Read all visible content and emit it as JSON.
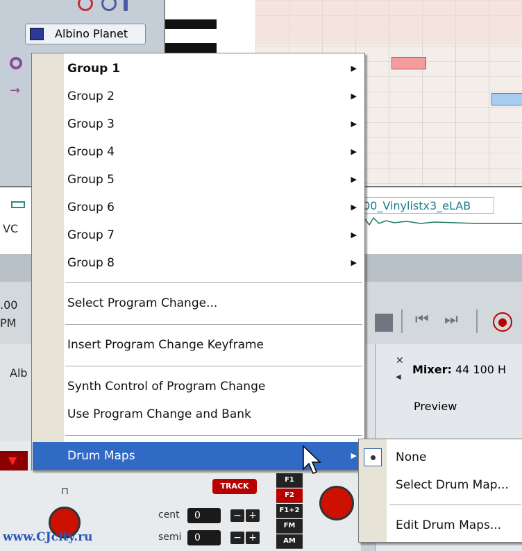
{
  "background": {
    "instrument_button": "Albino Planet",
    "clip_name": "00_Vinylistx3_eLAB",
    "track_fragment": "VC",
    "left_fragments": [
      ".00",
      "PM",
      "Alb"
    ],
    "mixer_title_bold": "Mixer:",
    "mixer_title_rest": " 44 100 H",
    "preview_label": "Preview",
    "track_button": "TRACK",
    "cent_label": "cent",
    "semi_label": "semi",
    "cent_value": "0",
    "semi_value": "0",
    "fkeys": [
      "F1",
      "F2",
      "F1+2",
      "FM",
      "AM"
    ],
    "watermark": "www.CJcity.ru"
  },
  "context_menu": {
    "items": [
      {
        "label": "Group 1",
        "submenu": true,
        "bold": true
      },
      {
        "label": "Group 2",
        "submenu": true
      },
      {
        "label": "Group 3",
        "submenu": true
      },
      {
        "label": "Group 4",
        "submenu": true
      },
      {
        "label": "Group 5",
        "submenu": true
      },
      {
        "label": "Group 6",
        "submenu": true
      },
      {
        "label": "Group 7",
        "submenu": true
      },
      {
        "label": "Group 8",
        "submenu": true
      },
      {
        "label": "Select Program Change..."
      },
      {
        "label": "Insert Program Change Keyframe"
      },
      {
        "label": "Synth Control of Program Change"
      },
      {
        "label": "Use Program Change and Bank"
      },
      {
        "label": "Drum Maps",
        "submenu": true,
        "highlighted": true
      }
    ],
    "submenu_arrow": "▶"
  },
  "drum_maps_submenu": {
    "items": [
      {
        "label": "None",
        "selected": true
      },
      {
        "label": "Select Drum Map..."
      },
      {
        "label": "Edit Drum Maps..."
      }
    ]
  },
  "colors": {
    "menu_highlight": "#316ac5",
    "menu_gutter": "#e7e3d6"
  }
}
